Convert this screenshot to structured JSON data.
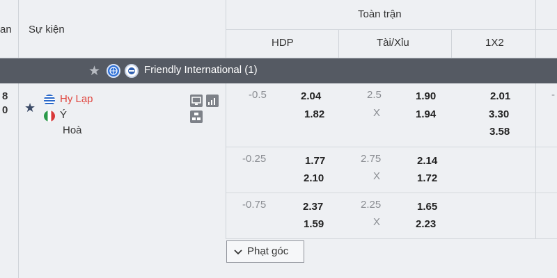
{
  "header": {
    "col_time_partial": "an",
    "col_event": "Sự kiện",
    "group_title": "Toàn trận",
    "col_hdp": "HDP",
    "col_ou": "Tài/Xỉu",
    "col_1x2": "1X2"
  },
  "league": {
    "name": "Friendly International (1)"
  },
  "match": {
    "time_partial_1": "8",
    "time_partial_2": "0",
    "home": "Hy Lạp",
    "away": "Ý",
    "draw": "Hoà",
    "markets": [
      {
        "hdp_line": "-0.5",
        "hdp_home": "2.04",
        "hdp_away": "1.82",
        "ou_line": "2.5",
        "ou_x": "X",
        "ou_over": "1.90",
        "ou_under": "1.94",
        "x12_home": "2.01",
        "x12_away": "3.30",
        "x12_draw": "3.58"
      },
      {
        "hdp_line": "-0.25",
        "hdp_home": "1.77",
        "hdp_away": "2.10",
        "ou_line": "2.75",
        "ou_x": "X",
        "ou_over": "2.14",
        "ou_under": "1.72"
      },
      {
        "hdp_line": "-0.75",
        "hdp_home": "2.37",
        "hdp_away": "1.59",
        "ou_line": "2.25",
        "ou_x": "X",
        "ou_over": "1.65",
        "ou_under": "2.23"
      }
    ],
    "right_partial": "-",
    "corner_button": "Phạt góc"
  },
  "colors": {
    "league_bar": "#555a63",
    "home_team": "#e0453e",
    "background": "#eef0f3"
  }
}
